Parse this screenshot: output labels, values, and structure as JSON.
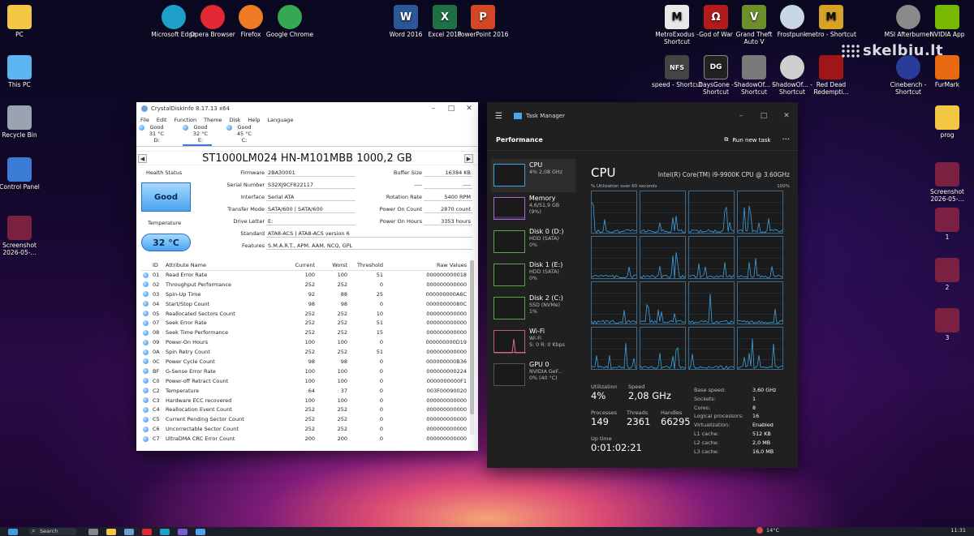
{
  "desktop": {
    "icons": [
      {
        "label": "PC",
        "icon": "folder-icon",
        "color": "#f3c744",
        "left": 0
      },
      {
        "label": "This PC",
        "icon": "monitor-icon",
        "color": "#5bb6ef"
      },
      {
        "label": "Recycle Bin",
        "icon": "recycle-bin-icon",
        "color": "#9aa3b0"
      },
      {
        "label": "Control Panel",
        "icon": "control-panel-icon",
        "color": "#3b7bd6"
      },
      {
        "label": "Screenshot 2026-05-...",
        "icon": "screenshot-icon",
        "color": "#7a2040"
      },
      {
        "label": "Microsoft Edge",
        "icon": "edge-icon",
        "color": "#1fa0c8"
      },
      {
        "label": "Opera Browser",
        "icon": "opera-icon",
        "color": "#e22833"
      },
      {
        "label": "Firefox",
        "icon": "firefox-icon",
        "color": "#f07a25"
      },
      {
        "label": "Google Chrome",
        "icon": "chrome-icon",
        "color": "#35a853"
      },
      {
        "label": "Word 2016",
        "icon": "word-icon",
        "color": "#2b5797"
      },
      {
        "label": "Excel 2016",
        "icon": "excel-icon",
        "color": "#1e7145"
      },
      {
        "label": "PowerPoint 2016",
        "icon": "powerpoint-icon",
        "color": "#d24726"
      },
      {
        "label": "MetroExodus - Shortcut",
        "icon": "metro-exodus-icon",
        "color": "#e8e8e8"
      },
      {
        "label": "God of War",
        "icon": "god-of-war-icon",
        "color": "#b31b1b"
      },
      {
        "label": "Grand Theft Auto V",
        "icon": "gta-icon",
        "color": "#6b8f2a"
      },
      {
        "label": "Frostpunk",
        "icon": "frostpunk-icon",
        "color": "#c9d6e3"
      },
      {
        "label": "metro - Shortcut",
        "icon": "metro-icon",
        "color": "#d8a227"
      },
      {
        "label": "MSI Afterburner",
        "icon": "msi-afterburner-icon",
        "color": "#8a8a8a"
      },
      {
        "label": "NVIDIA App",
        "icon": "nvidia-icon",
        "color": "#76b900"
      },
      {
        "label": "speed - Shortcut",
        "icon": "nfs-icon",
        "color": "#444"
      },
      {
        "label": "DaysGone - Shortcut",
        "icon": "days-gone-icon",
        "color": "#222"
      },
      {
        "label": "ShadowOf... - Shortcut",
        "icon": "shadow-icon",
        "color": "#7a7a7a"
      },
      {
        "label": "ShadowOf... - Shortcut",
        "icon": "shadow2-icon",
        "color": "#cfcfcf"
      },
      {
        "label": "Red Dead Redempti...",
        "icon": "rdr-icon",
        "color": "#a01515"
      },
      {
        "label": "Cinebench - Shortcut",
        "icon": "cinebench-icon",
        "color": "#2a3c9a"
      },
      {
        "label": "FurMark",
        "icon": "furmark-icon",
        "color": "#e86a10"
      },
      {
        "label": "prog",
        "icon": "folder-icon",
        "color": "#f3c744"
      },
      {
        "label": "Screenshot 2026-05-...",
        "icon": "screenshot-icon",
        "color": "#7a2040"
      },
      {
        "label": "1",
        "icon": "screenshot-icon",
        "color": "#7a2040"
      },
      {
        "label": "2",
        "icon": "screenshot-icon",
        "color": "#7a2040"
      },
      {
        "label": "3",
        "icon": "screenshot-icon",
        "color": "#7a2040"
      }
    ],
    "watermark": "skelbiu.lt"
  },
  "cdi": {
    "title": "CrystalDiskInfo 8.17.13 x64",
    "menu": [
      "File",
      "Edit",
      "Function",
      "Theme",
      "Disk",
      "Help",
      "Language"
    ],
    "drives": [
      {
        "status": "Good",
        "temp": "31 °C",
        "letter": "D:"
      },
      {
        "status": "Good",
        "temp": "32 °C",
        "letter": "E:"
      },
      {
        "status": "Good",
        "temp": "45 °C",
        "letter": "C:"
      }
    ],
    "model": "ST1000LM024 HN-M101MBB 1000,2 GB",
    "health_label": "Health Status",
    "health_value": "Good",
    "temp_label": "Temperature",
    "temp_value": "32 °C",
    "fields": {
      "firmware_label": "Firmware",
      "firmware": "2BA30001",
      "serial_label": "Serial Number",
      "serial": "S32XJ9CF822117",
      "interface_label": "Interface",
      "interface": "Serial ATA",
      "transfer_label": "Transfer Mode",
      "transfer": "SATA/600 | SATA/600",
      "letter_label": "Drive Letter",
      "letter": "E:",
      "standard_label": "Standard",
      "standard": "ATA8-ACS | ATA8-ACS version 6",
      "features_label": "Features",
      "features": "S.M.A.R.T., APM, AAM, NCQ, GPL",
      "buffer_label": "Buffer Size",
      "buffer": "16384 KB",
      "blank1_label": "----",
      "blank1": "----",
      "rotation_label": "Rotation Rate",
      "rotation": "5400 RPM",
      "poweron_count_label": "Power On Count",
      "poweron_count": "2870 count",
      "poweron_hours_label": "Power On Hours",
      "poweron_hours": "3353 hours"
    },
    "table_headers": [
      "ID",
      "Attribute Name",
      "Current",
      "Worst",
      "Threshold",
      "Raw Values"
    ],
    "rows": [
      [
        "01",
        "Read Error Rate",
        "100",
        "100",
        "51",
        "000000000018"
      ],
      [
        "02",
        "Throughput Performance",
        "252",
        "252",
        "0",
        "000000000000"
      ],
      [
        "03",
        "Spin-Up Time",
        "92",
        "88",
        "25",
        "000000000A6C"
      ],
      [
        "04",
        "Start/Stop Count",
        "98",
        "98",
        "0",
        "00000000080C"
      ],
      [
        "05",
        "Reallocated Sectors Count",
        "252",
        "252",
        "10",
        "000000000000"
      ],
      [
        "07",
        "Seek Error Rate",
        "252",
        "252",
        "51",
        "000000000000"
      ],
      [
        "08",
        "Seek Time Performance",
        "252",
        "252",
        "15",
        "000000000000"
      ],
      [
        "09",
        "Power-On Hours",
        "100",
        "100",
        "0",
        "000000000D19"
      ],
      [
        "0A",
        "Spin Retry Count",
        "252",
        "252",
        "51",
        "000000000000"
      ],
      [
        "0C",
        "Power Cycle Count",
        "98",
        "98",
        "0",
        "000000000B36"
      ],
      [
        "BF",
        "G-Sense Error Rate",
        "100",
        "100",
        "0",
        "000000000224"
      ],
      [
        "C0",
        "Power-off Retract Count",
        "100",
        "100",
        "0",
        "0000000000F1"
      ],
      [
        "C2",
        "Temperature",
        "64",
        "37",
        "0",
        "003F00090020"
      ],
      [
        "C3",
        "Hardware ECC recovered",
        "100",
        "100",
        "0",
        "000000000000"
      ],
      [
        "C4",
        "Reallocation Event Count",
        "252",
        "252",
        "0",
        "000000000000"
      ],
      [
        "C5",
        "Current Pending Sector Count",
        "252",
        "252",
        "0",
        "000000000000"
      ],
      [
        "C6",
        "Uncorrectable Sector Count",
        "252",
        "252",
        "0",
        "000000000000"
      ],
      [
        "C7",
        "UltraDMA CRC Error Count",
        "200",
        "200",
        "0",
        "000000000000"
      ]
    ],
    "status_color": "#4aa3f0"
  },
  "tm": {
    "title": "Task Manager",
    "section": "Performance",
    "run_new_task": "Run new task",
    "sidebar": [
      {
        "name": "CPU",
        "line1": "4%  2,08 GHz",
        "line2": ""
      },
      {
        "name": "Memory",
        "line1": "4,6/51,9 GB (9%)",
        "line2": ""
      },
      {
        "name": "Disk 0 (D:)",
        "line1": "HDD (SATA)",
        "line2": "0%"
      },
      {
        "name": "Disk 1 (E:)",
        "line1": "HDD (SATA)",
        "line2": "0%"
      },
      {
        "name": "Disk 2 (C:)",
        "line1": "SSD (NVMe)",
        "line2": "1%"
      },
      {
        "name": "Wi-Fi",
        "line1": "Wi-Fi",
        "line2": "S: 0  R: 0 Kbps"
      },
      {
        "name": "GPU 0",
        "line1": "NVIDIA GeF...",
        "line2": "0% (40 °C)"
      }
    ],
    "cpu_title": "CPU",
    "cpu_name": "Intel(R) Core(TM) i9-9900K CPU @ 3.60GHz",
    "graph_caption": "% Utilization over 60 seconds",
    "graph_max": "100%",
    "stats": {
      "utilization_label": "Utilization",
      "utilization": "4%",
      "speed_label": "Speed",
      "speed": "2,08 GHz",
      "processes_label": "Processes",
      "processes": "149",
      "threads_label": "Threads",
      "threads": "2361",
      "handles_label": "Handles",
      "handles": "66295",
      "uptime_label": "Up time",
      "uptime": "0:01:02:21"
    },
    "specs": [
      [
        "Base speed:",
        "3,60 GHz"
      ],
      [
        "Sockets:",
        "1"
      ],
      [
        "Cores:",
        "8"
      ],
      [
        "Logical processors:",
        "16"
      ],
      [
        "Virtualization:",
        "Enabled"
      ],
      [
        "L1 cache:",
        "512 KB"
      ],
      [
        "L2 cache:",
        "2,0 MB"
      ],
      [
        "L3 cache:",
        "16,0 MB"
      ]
    ],
    "graph_color": "#3ea1dc"
  },
  "taskbar": {
    "search": "Search",
    "weather": "14°C",
    "time": "11:31"
  }
}
